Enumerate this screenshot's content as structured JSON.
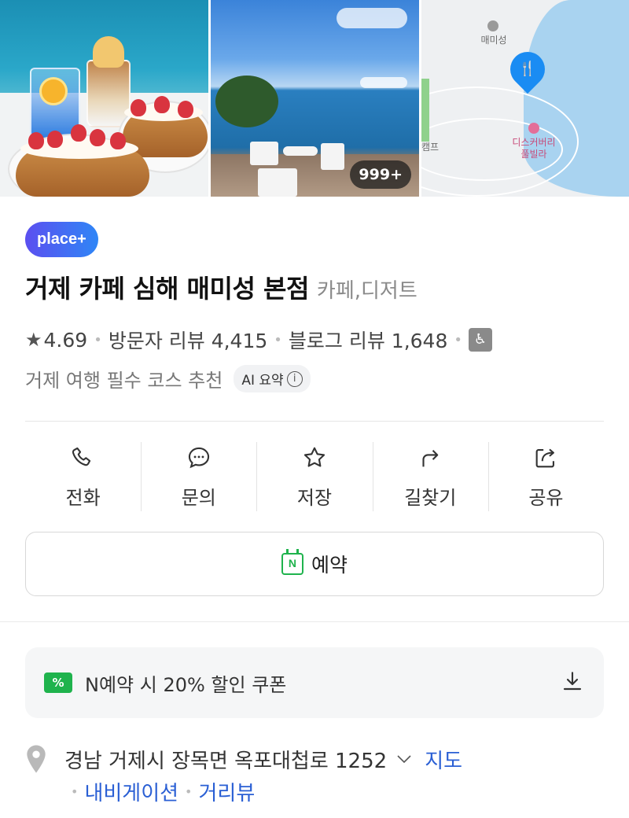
{
  "photos": {
    "count_badge": "999+",
    "map": {
      "poi_top": "매미성",
      "poi_left": "캠프",
      "poi_right": "디스커버리\n풀빌라"
    }
  },
  "place": {
    "badge": "place+",
    "title": "거제 카페 심해 매미성 본점",
    "category": "카페,디저트",
    "rating": "4.69",
    "visitor_reviews": "방문자 리뷰 4,415",
    "blog_reviews": "블로그 리뷰 1,648",
    "summary": "거제 여행 필수 코스 추천",
    "ai_chip": "AI 요약"
  },
  "actions": [
    {
      "label": "전화",
      "icon": "phone-icon"
    },
    {
      "label": "문의",
      "icon": "chat-icon"
    },
    {
      "label": "저장",
      "icon": "star-icon"
    },
    {
      "label": "길찾기",
      "icon": "directions-icon"
    },
    {
      "label": "공유",
      "icon": "share-icon"
    }
  ],
  "reserve_label": "예약",
  "coupon": {
    "icon_text": "%",
    "text": "N예약 시 20% 할인 쿠폰"
  },
  "address": {
    "text": "경남 거제시 장목면 옥포대첩로 1252",
    "map_link": "지도",
    "links": [
      "내비게이션",
      "거리뷰"
    ]
  },
  "colors": {
    "brand_blue": "#2f86f6",
    "naver_green": "#1fb34d",
    "link_blue": "#2a5fd4"
  }
}
